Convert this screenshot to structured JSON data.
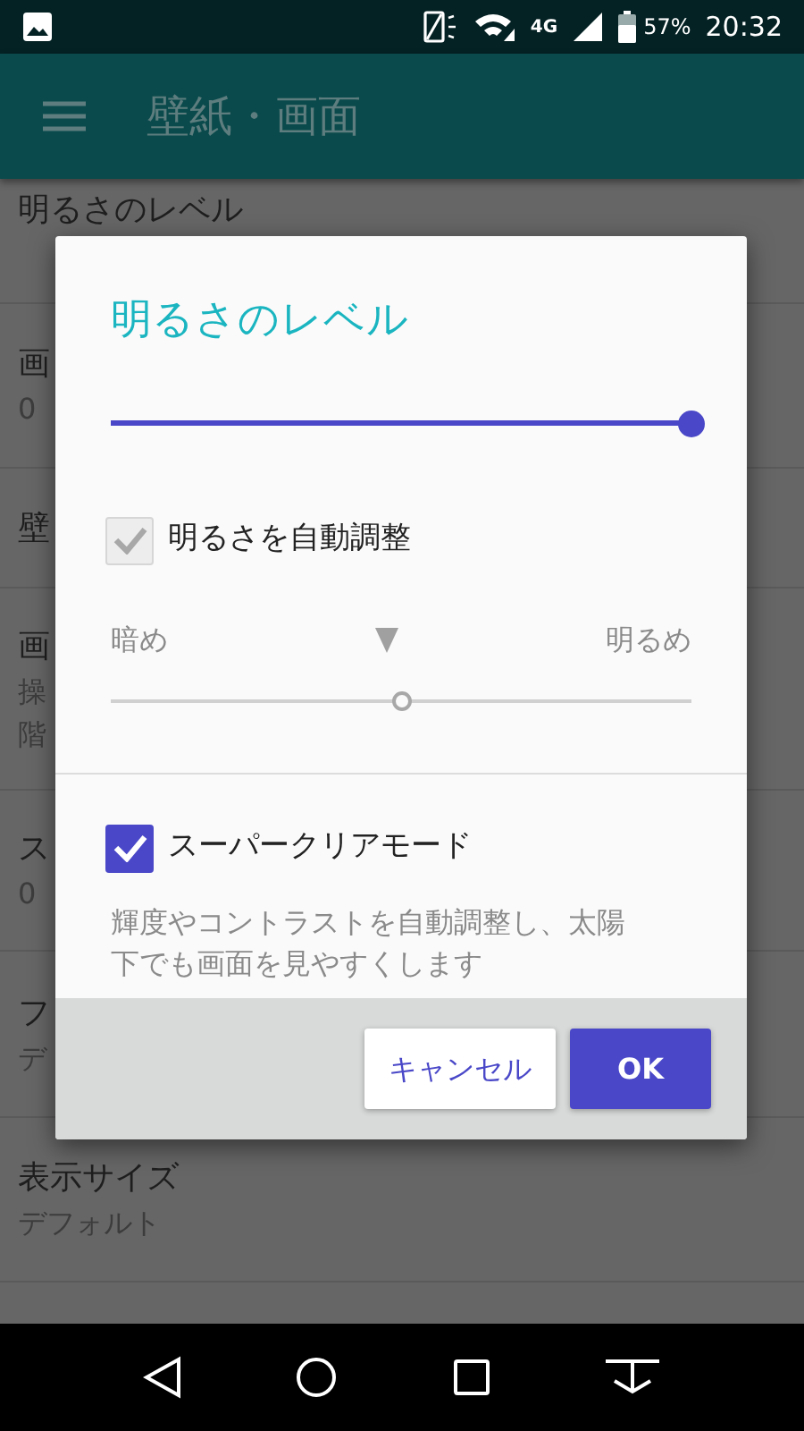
{
  "status_bar": {
    "network": "4G",
    "battery": "57%",
    "time": "20:32"
  },
  "app_bar": {
    "title": "壁紙・画面"
  },
  "settings": [
    {
      "title": "明るさのレベル"
    },
    {
      "title": "画",
      "subtitle": "0"
    },
    {
      "title": "壁"
    },
    {
      "title": "画",
      "subtitle": "操",
      "subtitle_2": "階"
    },
    {
      "title": "ス",
      "subtitle": "0"
    },
    {
      "title": "フ",
      "subtitle": "デ"
    },
    {
      "title": "表示サイズ",
      "subtitle": "デフォルト"
    }
  ],
  "dialog": {
    "title": "明るさのレベル",
    "brightness": {
      "level": 1.0
    },
    "auto_adjust": {
      "label": "明るさを自動調整",
      "checked": true,
      "disabled": true
    },
    "adjust_low": "暗め",
    "adjust_high": "明るめ",
    "adjust": {
      "level": 0.5,
      "disabled": true
    },
    "super_clear": {
      "label": "スーパークリアモード",
      "checked": true,
      "disabled": false
    },
    "description": "輝度やコントラストを自動調整し、太陽下でも画面を見やすくします",
    "buttons": [
      {
        "label": "キャンセル",
        "kind": "secondary"
      },
      {
        "label": "OK",
        "kind": "primary"
      }
    ]
  }
}
